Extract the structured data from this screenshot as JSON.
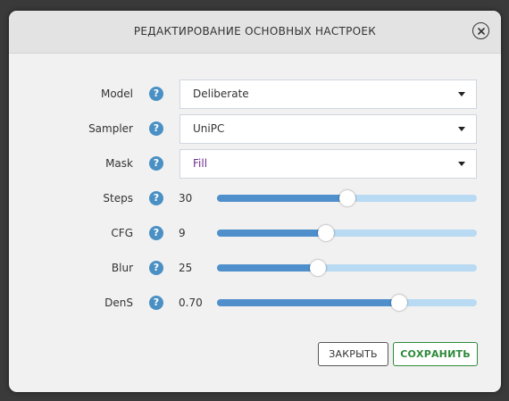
{
  "dialog": {
    "title": "РЕДАКТИРОВАНИЕ ОСНОВНЫХ НАСТРОЕК",
    "help_glyph": "?",
    "fields": {
      "model": {
        "label": "Model",
        "value": "Deliberate"
      },
      "sampler": {
        "label": "Sampler",
        "value": "UniPC"
      },
      "mask": {
        "label": "Mask",
        "value": "Fill"
      }
    },
    "sliders": {
      "steps": {
        "label": "Steps",
        "value": "30",
        "fraction": 0.5
      },
      "cfg": {
        "label": "CFG",
        "value": "9",
        "fraction": 0.42
      },
      "blur": {
        "label": "Blur",
        "value": "25",
        "fraction": 0.39
      },
      "dens": {
        "label": "DenS",
        "value": "0.70",
        "fraction": 0.7
      }
    },
    "buttons": {
      "close": "ЗАКРЫТЬ",
      "save": "СОХРАНИТЬ"
    }
  },
  "colors": {
    "accent": "#4e8fcc",
    "track": "#b8daf2",
    "save": "#2d8a3a",
    "mask_value": "#6b2e8f"
  },
  "icons": {
    "close": "close-icon",
    "help": "help-icon",
    "dropdown": "chevron-down-icon"
  }
}
